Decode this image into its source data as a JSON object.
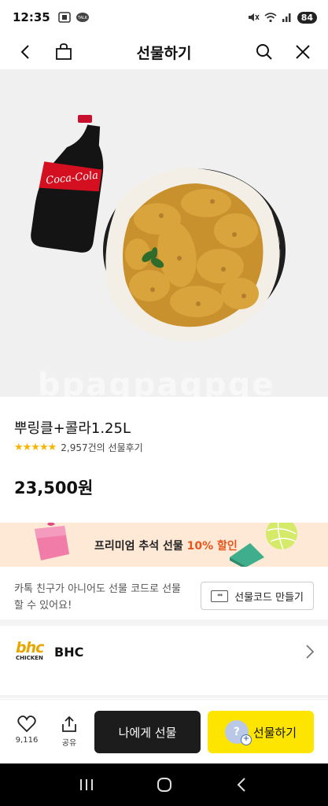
{
  "status_bar": {
    "time": "12:35",
    "battery": "84"
  },
  "header": {
    "title": "선물하기"
  },
  "product": {
    "title": "뿌링클+콜라1.25L",
    "rating_stars": "★★★★★",
    "review_count": "2,957건의 선물후기",
    "price": "23,500원"
  },
  "promo": {
    "text_main": "프리미엄 추석 선물 ",
    "text_highlight": "10% 할인"
  },
  "gift_code": {
    "description": "카톡 친구가 아니어도 선물 코드로 선물 할 수 있어요!",
    "button_label": "선물코드 만들기",
    "button_icon_text": "**"
  },
  "brand": {
    "logo_top": "bhc",
    "logo_bottom": "CHICKEN",
    "name": "BHC"
  },
  "bottom_bar": {
    "like_count": "9,116",
    "share_label": "공유",
    "gift_self_label": "나에게 선물",
    "gift_label": "선물하기",
    "gift_icon_text": "?",
    "gift_icon_plus": "+"
  },
  "colors": {
    "accent_yellow": "#fee500",
    "promo_bg": "#fde9d6",
    "promo_highlight": "#e8561c",
    "brand_yellow": "#e8a600",
    "star": "#f7b500"
  }
}
